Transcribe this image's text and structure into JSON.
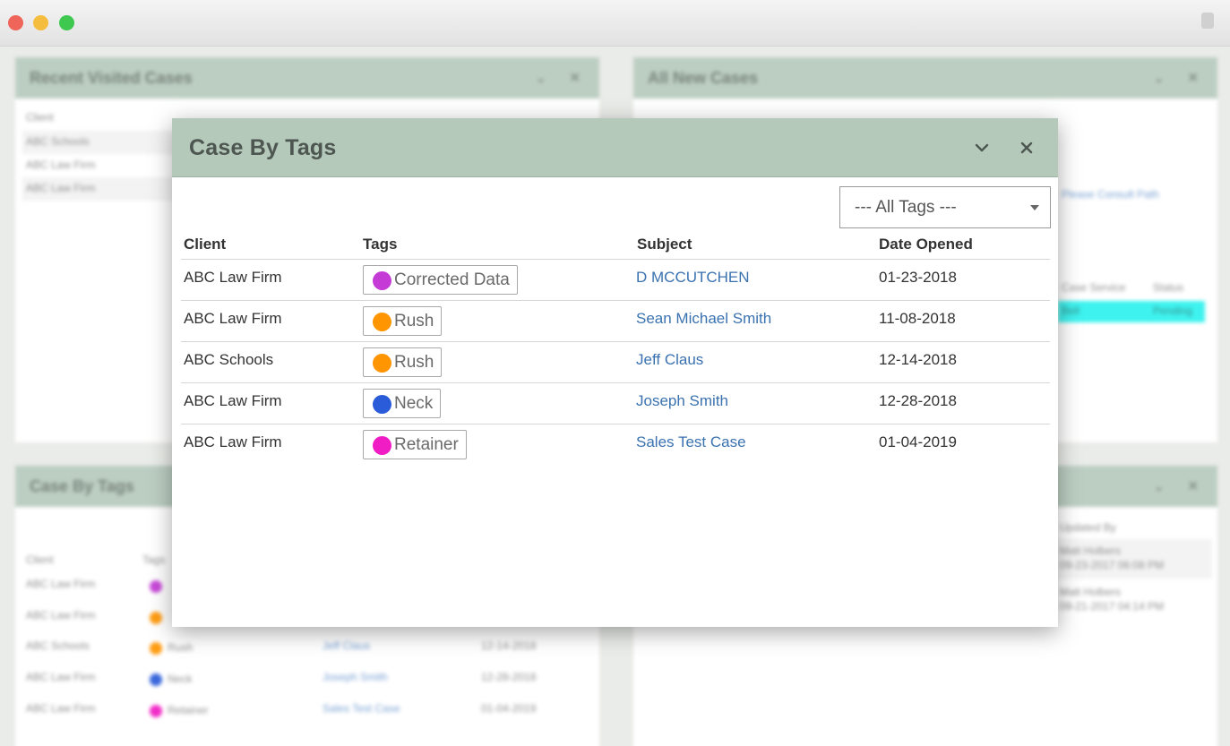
{
  "colors": {
    "header_bg": "#b5c9bb",
    "link": "#3a72b0",
    "tag_corrected_data": "#c43bd6",
    "tag_rush": "#ff9500",
    "tag_neck": "#2a5bd8",
    "tag_retainer": "#f01cc4"
  },
  "background": {
    "recent_visited": {
      "title": "Recent Visited Cases",
      "col_client": "Client",
      "rows": [
        "ABC Schools",
        "ABC Law Firm",
        "ABC Law Firm"
      ]
    },
    "all_new_cases": {
      "title": "All New Cases",
      "link_text": "Please Consult Path",
      "col_case_service": "Case Service",
      "col_status": "Status",
      "status_value": "Pending",
      "row_value": "Bell"
    },
    "case_by_tags": {
      "title": "Case By Tags",
      "col_client": "Client",
      "col_tags": "Tags",
      "rows": [
        {
          "client": "ABC Law Firm",
          "tag": "",
          "subject": "",
          "date": ""
        },
        {
          "client": "ABC Law Firm",
          "tag": "",
          "subject": "",
          "date": ""
        },
        {
          "client": "ABC Schools",
          "tag": "Rush",
          "subject": "Jeff Claus",
          "date": "12-14-2018"
        },
        {
          "client": "ABC Law Firm",
          "tag": "Neck",
          "subject": "Joseph Smith",
          "date": "12-28-2018"
        },
        {
          "client": "ABC Law Firm",
          "tag": "Retainer",
          "subject": "Sales Test Case",
          "date": "01-04-2019"
        }
      ]
    },
    "updated_by": {
      "col_updated_by": "Updated By",
      "rows": [
        {
          "name": "Matt Holbers",
          "time": "09-23-2017 06:08 PM"
        },
        {
          "name": "Matt Holbers",
          "time": "09-21-2017 04:14 PM"
        }
      ]
    }
  },
  "modal": {
    "title": "Case By Tags",
    "collapse_icon": "chevron-down-icon",
    "close_icon": "close-icon",
    "tag_filter": {
      "selected": "--- All Tags ---"
    },
    "columns": {
      "client": "Client",
      "tags": "Tags",
      "subject": "Subject",
      "date_opened": "Date Opened"
    },
    "rows": [
      {
        "client": "ABC Law Firm",
        "tag": "Corrected Data",
        "tag_color": "#c43bd6",
        "subject": "D MCCUTCHEN",
        "date_opened": "01-23-2018"
      },
      {
        "client": "ABC Law Firm",
        "tag": "Rush",
        "tag_color": "#ff9500",
        "subject": "Sean Michael Smith",
        "date_opened": "11-08-2018"
      },
      {
        "client": "ABC Schools",
        "tag": "Rush",
        "tag_color": "#ff9500",
        "subject": "Jeff Claus",
        "date_opened": "12-14-2018"
      },
      {
        "client": "ABC Law Firm",
        "tag": "Neck",
        "tag_color": "#2a5bd8",
        "subject": "Joseph Smith",
        "date_opened": "12-28-2018"
      },
      {
        "client": "ABC Law Firm",
        "tag": "Retainer",
        "tag_color": "#f01cc4",
        "subject": "Sales Test Case",
        "date_opened": "01-04-2019"
      }
    ]
  }
}
